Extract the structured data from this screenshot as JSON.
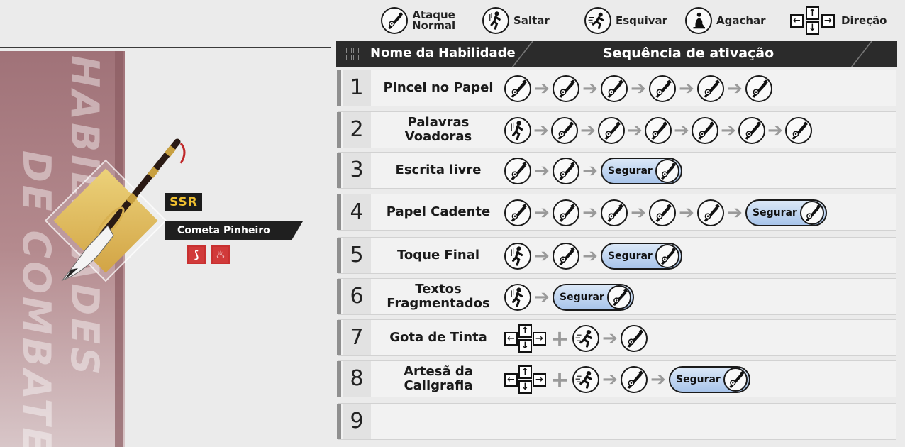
{
  "banner": {
    "title_line1": "HABILIDADES",
    "title_line2": "DE COMBATE"
  },
  "weapon": {
    "rarity": "SSR",
    "name": "Cometa Pinheiro",
    "element_icons": [
      "weapon-type-icon",
      "fire-icon"
    ]
  },
  "legend": [
    {
      "icon": "attack-icon",
      "label": "Ataque\nNormal"
    },
    {
      "icon": "jump-icon",
      "label": "Saltar"
    },
    {
      "icon": "dodge-icon",
      "label": "Esquivar"
    },
    {
      "icon": "crouch-icon",
      "label": "Agachar"
    },
    {
      "icon": "direction-icon",
      "label": "Direção"
    }
  ],
  "table": {
    "col1": "Nome da Habilidade",
    "col2": "Sequência de ativação",
    "hold_label": "Segurar",
    "rows": [
      {
        "num": "1",
        "name": "Pincel no Papel",
        "seq": [
          "A",
          "A",
          "A",
          "A",
          "A",
          "A"
        ]
      },
      {
        "num": "2",
        "name": "Palavras Voadoras",
        "seq": [
          "J",
          "A",
          "A",
          "A",
          "A",
          "A",
          "A"
        ]
      },
      {
        "num": "3",
        "name": "Escrita livre",
        "seq": [
          "A",
          "A",
          "H"
        ]
      },
      {
        "num": "4",
        "name": "Papel Cadente",
        "seq": [
          "A",
          "A",
          "A",
          "A",
          "A",
          "H"
        ]
      },
      {
        "num": "5",
        "name": "Toque Final",
        "seq": [
          "J",
          "A",
          "H"
        ]
      },
      {
        "num": "6",
        "name": "Textos\nFragmentados",
        "seq": [
          "J",
          "H"
        ]
      },
      {
        "num": "7",
        "name": "Gota de Tinta",
        "seq": [
          "D",
          "+",
          "E",
          "A"
        ]
      },
      {
        "num": "8",
        "name": "Artesã da\nCaligrafia",
        "seq": [
          "D",
          "+",
          "E",
          "A",
          "H"
        ]
      },
      {
        "num": "9",
        "name": "",
        "seq": []
      }
    ]
  },
  "colors": {
    "accent_gold": "#f0c030",
    "banner": "#a07278",
    "hold_blue": "#a8c4ea",
    "fire": "#d13a3a"
  }
}
